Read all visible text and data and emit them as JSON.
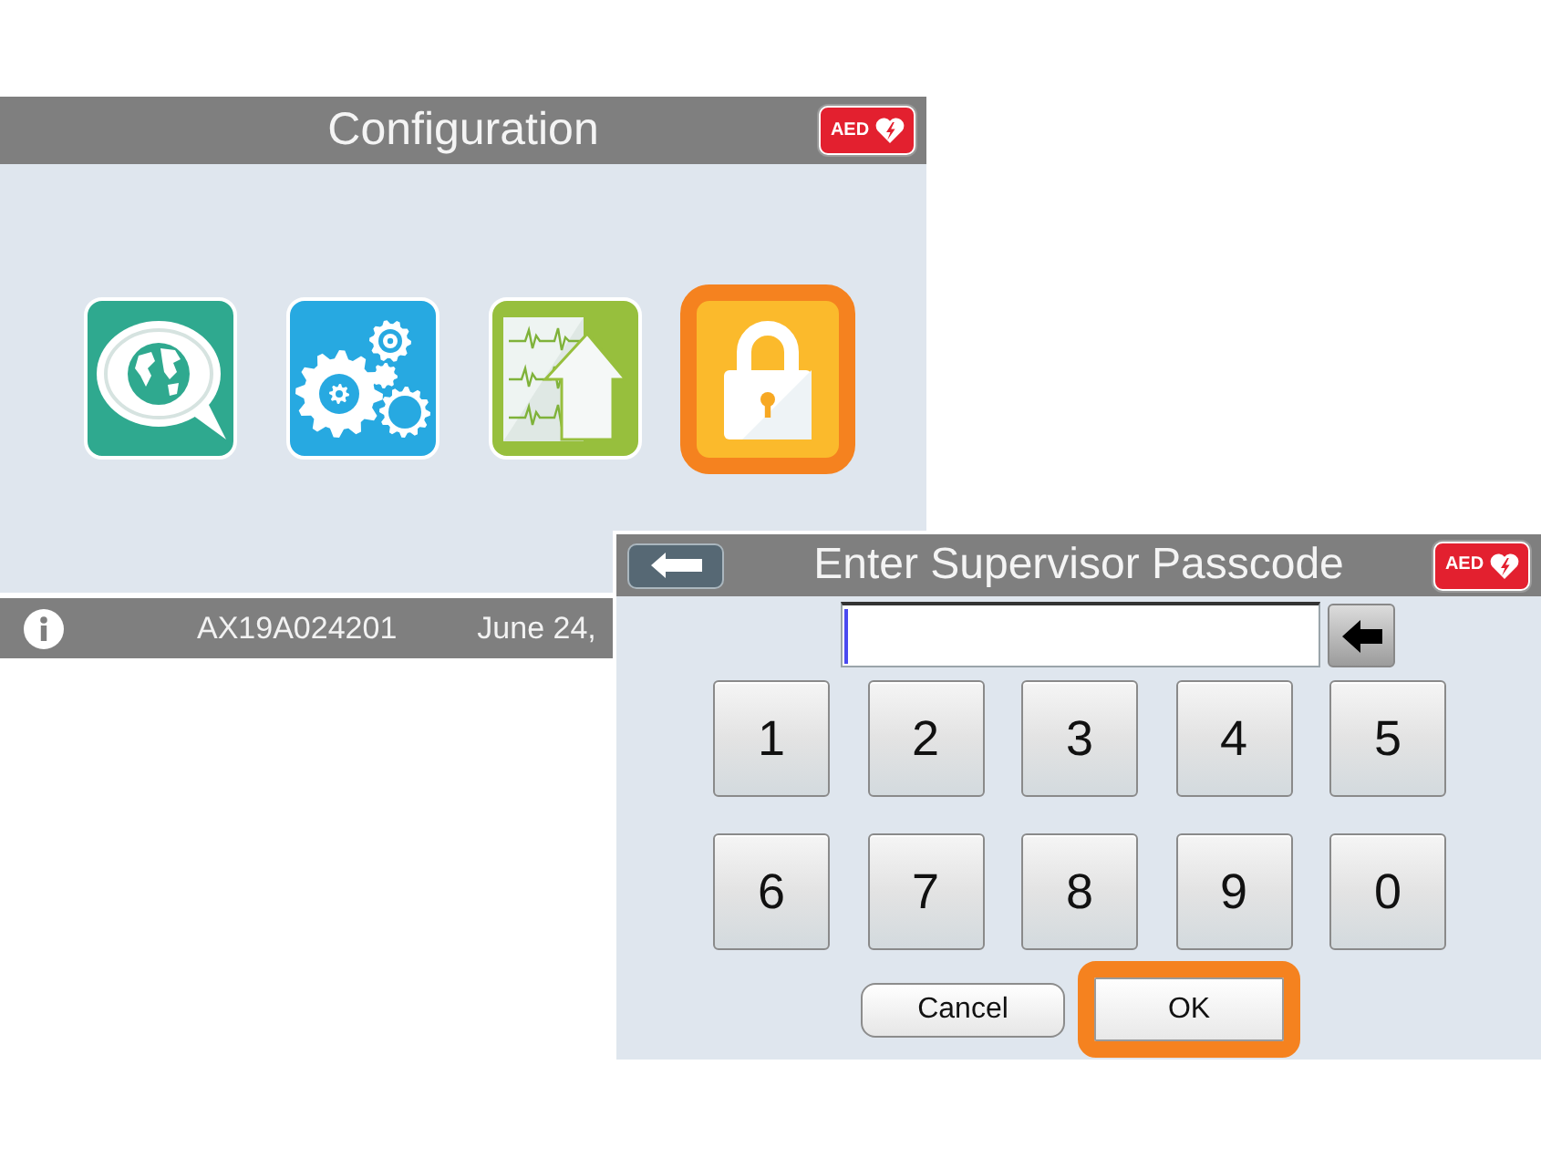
{
  "configuration_screen": {
    "title": "Configuration",
    "badge": "AED",
    "tiles": [
      {
        "kind": "language",
        "selected": false
      },
      {
        "kind": "settings",
        "selected": false
      },
      {
        "kind": "export",
        "selected": false
      },
      {
        "kind": "security",
        "selected": true
      }
    ],
    "status_bar": {
      "serial_number": "AX19A024201",
      "date": "June 24,"
    }
  },
  "passcode_dialog": {
    "title": "Enter Supervisor Passcode",
    "badge": "AED",
    "passcode_field": {
      "focused": true
    },
    "keys": [
      "1",
      "2",
      "3",
      "4",
      "5",
      "6",
      "7",
      "8",
      "9",
      "0"
    ],
    "buttons": [
      {
        "label": "Cancel",
        "selected": false
      },
      {
        "label": "OK",
        "selected": true
      }
    ]
  }
}
